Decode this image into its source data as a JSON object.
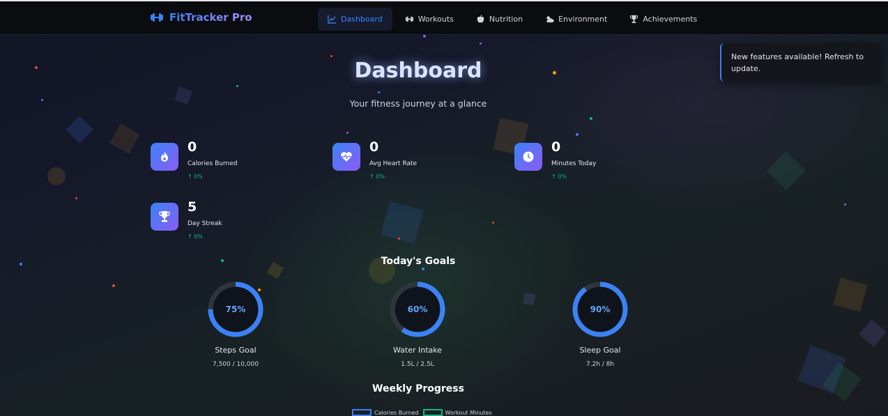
{
  "app": {
    "title": "FitTracker Pro"
  },
  "nav": {
    "items": [
      {
        "label": "Dashboard",
        "icon": "chart-line-icon",
        "active": true
      },
      {
        "label": "Workouts",
        "icon": "dumbbell-icon",
        "active": false
      },
      {
        "label": "Nutrition",
        "icon": "apple-icon",
        "active": false
      },
      {
        "label": "Environment",
        "icon": "cloud-sun-icon",
        "active": false
      },
      {
        "label": "Achievements",
        "icon": "trophy-icon",
        "active": false
      }
    ]
  },
  "toast": {
    "message": "New features available! Refresh to update."
  },
  "page": {
    "title": "Dashboard",
    "subtitle": "Your fitness journey at a glance"
  },
  "stats": [
    {
      "value": "0",
      "label": "Calories Burned",
      "change": "↑ 0%",
      "icon": "fire-icon"
    },
    {
      "value": "0",
      "label": "Avg Heart Rate",
      "change": "↑ 0%",
      "icon": "heart-pulse-icon"
    },
    {
      "value": "0",
      "label": "Minutes Today",
      "change": "↑ 0%",
      "icon": "clock-icon"
    },
    {
      "value": "5",
      "label": "Day Streak",
      "change": "↑ 0%",
      "icon": "trophy-icon"
    }
  ],
  "goals": {
    "title": "Today's Goals",
    "items": [
      {
        "percent_label": "75%",
        "progress": 0.75,
        "name": "Steps Goal",
        "detail": "7,500 / 10,000"
      },
      {
        "percent_label": "60%",
        "progress": 0.6,
        "name": "Water Intake",
        "detail": "1.5L / 2.5L"
      },
      {
        "percent_label": "90%",
        "progress": 0.9,
        "name": "Sleep Goal",
        "detail": "7.2h / 8h"
      }
    ]
  },
  "weekly": {
    "title": "Weekly Progress",
    "legend": [
      {
        "label": "Calories Burned",
        "color": "#3b82f6"
      },
      {
        "label": "Workout Minutes",
        "color": "#10b981"
      }
    ]
  },
  "colors": {
    "accent": "#3b82f6",
    "accent2": "#8b5cf6",
    "positive": "#10b981"
  }
}
